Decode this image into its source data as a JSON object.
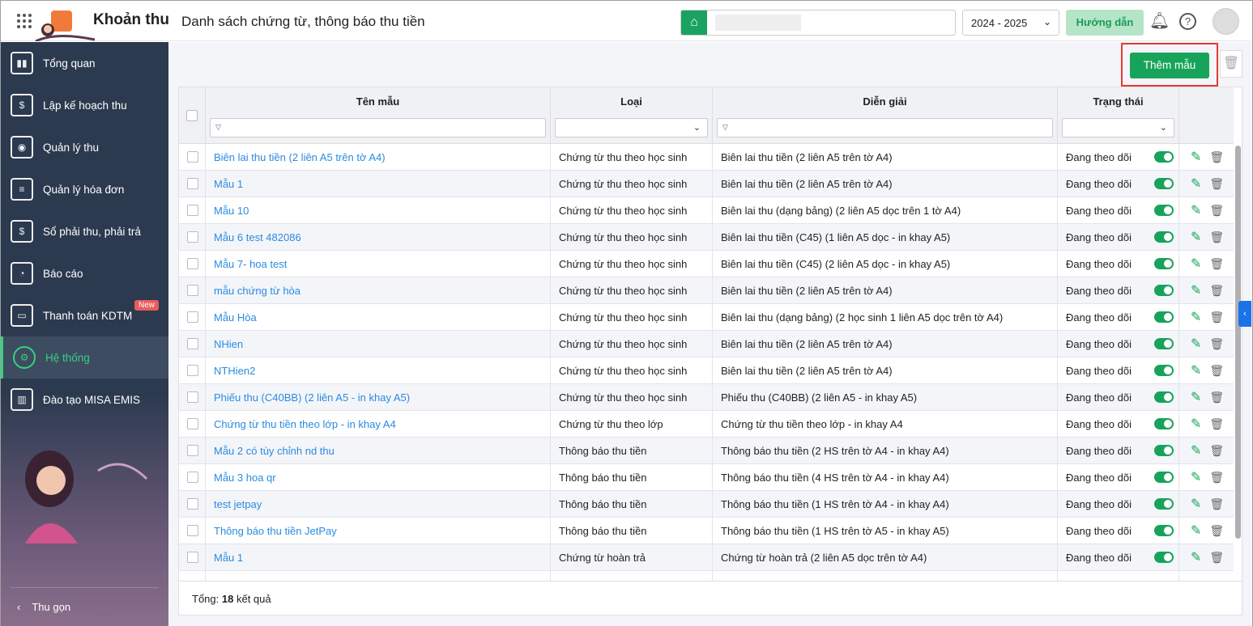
{
  "header": {
    "app_title": "Khoản thu",
    "page_title": "Danh sách chứng từ, thông báo thu tiền",
    "school_year": "2024 - 2025",
    "guide_label": "Hướng dẫn"
  },
  "sidebar": {
    "items": [
      {
        "label": "Tổng quan",
        "icon": "chart-bars-icon"
      },
      {
        "label": "Lập kế hoạch thu",
        "icon": "calendar-dollar-icon"
      },
      {
        "label": "Quản lý thu",
        "icon": "hand-coin-icon"
      },
      {
        "label": "Quản lý hóa đơn",
        "icon": "document-icon"
      },
      {
        "label": "Sổ phải thu, phải trả",
        "icon": "ledger-icon"
      },
      {
        "label": "Báo cáo",
        "icon": "pie-chart-icon"
      },
      {
        "label": "Thanh toán KDTM",
        "icon": "card-icon",
        "badge": "New"
      },
      {
        "label": "Hệ thống",
        "icon": "gear-icon",
        "active": true
      },
      {
        "label": "Đào tạo MISA EMIS",
        "icon": "book-icon"
      }
    ],
    "collapse_label": "Thu gọn"
  },
  "toolbar": {
    "add_label": "Thêm mẫu"
  },
  "table": {
    "columns": [
      "Tên mẫu",
      "Loại",
      "Diễn giải",
      "Trạng thái"
    ],
    "rows": [
      [
        "Biên lai thu tiền (2 liên A5 trên tờ A4)",
        "Chứng từ thu theo học sinh",
        "Biên lai thu tiền (2 liên A5 trên tờ A4)",
        "Đang theo dõi"
      ],
      [
        "Mẫu 1",
        "Chứng từ thu theo học sinh",
        "Biên lai thu tiền (2 liên A5 trên tờ A4)",
        "Đang theo dõi"
      ],
      [
        "Mẫu 10",
        "Chứng từ thu theo học sinh",
        "Biên lai thu (dạng bảng) (2 liên A5 dọc trên 1 tờ A4)",
        "Đang theo dõi"
      ],
      [
        "Mẫu 6 test 482086",
        "Chứng từ thu theo học sinh",
        "Biên lai thu tiền (C45) (1 liên A5 dọc - in khay A5)",
        "Đang theo dõi"
      ],
      [
        "Mẫu 7- hoa test",
        "Chứng từ thu theo học sinh",
        "Biên lai thu tiền (C45) (2 liên A5 dọc - in khay A5)",
        "Đang theo dõi"
      ],
      [
        "mẫu chứng từ hòa",
        "Chứng từ thu theo học sinh",
        "Biên lai thu tiền (2 liên A5 trên tờ A4)",
        "Đang theo dõi"
      ],
      [
        "Mẫu Hòa",
        "Chứng từ thu theo học sinh",
        "Biên lai thu (dạng bảng) (2 học sinh 1 liên A5 dọc trên tờ A4)",
        "Đang theo dõi"
      ],
      [
        "NHien",
        "Chứng từ thu theo học sinh",
        "Biên lai thu tiền (2 liên A5 trên tờ A4)",
        "Đang theo dõi"
      ],
      [
        "NTHien2",
        "Chứng từ thu theo học sinh",
        "Biên lai thu tiền (2 liên A5 trên tờ A4)",
        "Đang theo dõi"
      ],
      [
        "Phiếu thu (C40BB) (2 liên A5 - in khay A5)",
        "Chứng từ thu theo học sinh",
        "Phiếu thu (C40BB) (2 liên A5 - in khay A5)",
        "Đang theo dõi"
      ],
      [
        "Chứng từ thu tiền theo lớp - in khay A4",
        "Chứng từ thu theo lớp",
        "Chứng từ thu tiền theo lớp - in khay A4",
        "Đang theo dõi"
      ],
      [
        "Mẫu 2 có tùy chỉnh nd thu",
        "Thông báo thu tiền",
        "Thông báo thu tiền (2 HS trên tờ A4 - in khay A4)",
        "Đang theo dõi"
      ],
      [
        "Mẫu 3 hoa qr",
        "Thông báo thu tiền",
        "Thông báo thu tiền (4 HS trên tờ A4 - in khay A4)",
        "Đang theo dõi"
      ],
      [
        "test jetpay",
        "Thông báo thu tiền",
        "Thông báo thu tiền (1 HS trên tờ A4 - in khay A4)",
        "Đang theo dõi"
      ],
      [
        "Thông báo thu tiền JetPay",
        "Thông báo thu tiền",
        "Thông báo thu tiền (1 HS trên tờ A5 - in khay A5)",
        "Đang theo dõi"
      ],
      [
        "Mẫu 1",
        "Chứng từ hoàn trả",
        "Chứng từ hoàn trả (2 liên A5 dọc trên tờ A4)",
        "Đang theo dõi"
      ]
    ]
  },
  "footer": {
    "prefix": "Tổng:",
    "count": "18",
    "suffix": "kết quả"
  },
  "colors": {
    "accent": "#17a45a",
    "link": "#2a8be0",
    "sidebar": "#2b3a4f"
  }
}
